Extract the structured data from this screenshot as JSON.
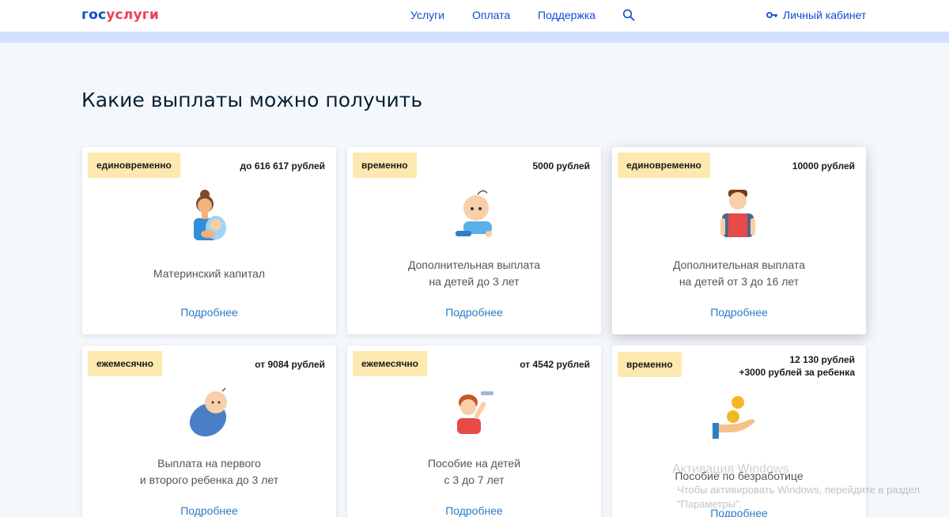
{
  "header": {
    "logo_part1": "гос",
    "logo_part2": "услуги",
    "nav": [
      "Услуги",
      "Оплата",
      "Поддержка"
    ],
    "cabinet_label": "Личный кабинет"
  },
  "page_title": "Какие выплаты можно получить",
  "cards": [
    {
      "badge": "единовременно",
      "amount": "до 616 617 рублей",
      "title1": "Материнский капитал",
      "title2": "",
      "more": "Подробнее",
      "icon": "mother-with-baby-icon"
    },
    {
      "badge": "временно",
      "amount": "5000 рублей",
      "title1": "Дополнительная выплата",
      "title2": "на детей до 3 лет",
      "more": "Подробнее",
      "icon": "crawling-baby-icon"
    },
    {
      "badge": "единовременно",
      "amount": "10000 рублей",
      "title1": "Дополнительная выплата",
      "title2": "на детей от 3 до 16 лет",
      "more": "Подробнее",
      "icon": "schoolboy-icon"
    },
    {
      "badge": "ежемесячно",
      "amount": "от 9084 рублей",
      "title1": "Выплата на первого",
      "title2": "и второго ребенка до 3 лет",
      "more": "Подробнее",
      "icon": "swaddled-baby-icon"
    },
    {
      "badge": "ежемесячно",
      "amount": "от 4542 рублей",
      "title1": "Пособие на детей",
      "title2": "с 3 до 7 лет",
      "more": "Подробнее",
      "icon": "child-with-toy-plane-icon"
    },
    {
      "badge": "временно",
      "amount": "12 130 рублей",
      "amount2": "+3000 рублей за ребенка",
      "title1": "Пособие по безработице",
      "title2": "",
      "more": "Подробнее",
      "icon": "hand-with-coins-icon"
    }
  ],
  "watermark": {
    "title": "Активация Windows",
    "line1": "Чтобы активировать Windows, перейдите в раздел",
    "line2": "\"Параметры\"."
  },
  "colors": {
    "brand_blue": "#0d4cd3",
    "brand_red": "#ee3f58",
    "badge_bg": "#fde9b0",
    "link": "#2b7bc4",
    "strip": "#d1e2ff"
  }
}
